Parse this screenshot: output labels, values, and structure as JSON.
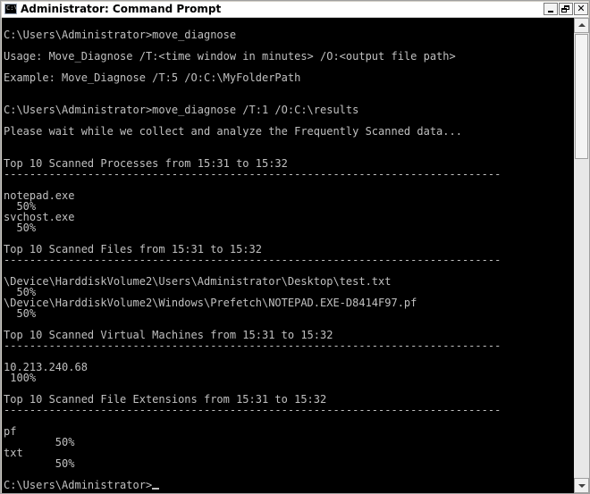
{
  "window": {
    "title": "Administrator: Command Prompt",
    "icon_name": "command-prompt-icon",
    "icon_glyph": "C:\\"
  },
  "colors": {
    "console_bg": "#000000",
    "console_text": "#c0c0c0"
  },
  "console": {
    "lines": [
      "C:\\Users\\Administrator>move_diagnose",
      "",
      "Usage: Move_Diagnose /T:<time window in minutes> /O:<output file path>",
      "",
      "Example: Move_Diagnose /T:5 /O:C:\\MyFolderPath",
      "",
      "",
      "C:\\Users\\Administrator>move_diagnose /T:1 /O:C:\\results",
      "",
      "Please wait while we collect and analyze the Frequently Scanned data...",
      "",
      "",
      "Top 10 Scanned Processes from 15:31 to 15:32",
      "-----------------------------------------------------------------------------",
      "",
      "notepad.exe",
      "  50%",
      "svchost.exe",
      "  50%",
      "",
      "Top 10 Scanned Files from 15:31 to 15:32",
      "-----------------------------------------------------------------------------",
      "",
      "\\Device\\HarddiskVolume2\\Users\\Administrator\\Desktop\\test.txt",
      "  50%",
      "\\Device\\HarddiskVolume2\\Windows\\Prefetch\\NOTEPAD.EXE-D8414F97.pf",
      "  50%",
      "",
      "Top 10 Scanned Virtual Machines from 15:31 to 15:32",
      "-----------------------------------------------------------------------------",
      "",
      "10.213.240.68",
      " 100%",
      "",
      "Top 10 Scanned File Extensions from 15:31 to 15:32",
      "-----------------------------------------------------------------------------",
      "",
      "pf",
      "        50%",
      "txt",
      "        50%",
      "",
      "C:\\Users\\Administrator>"
    ]
  }
}
